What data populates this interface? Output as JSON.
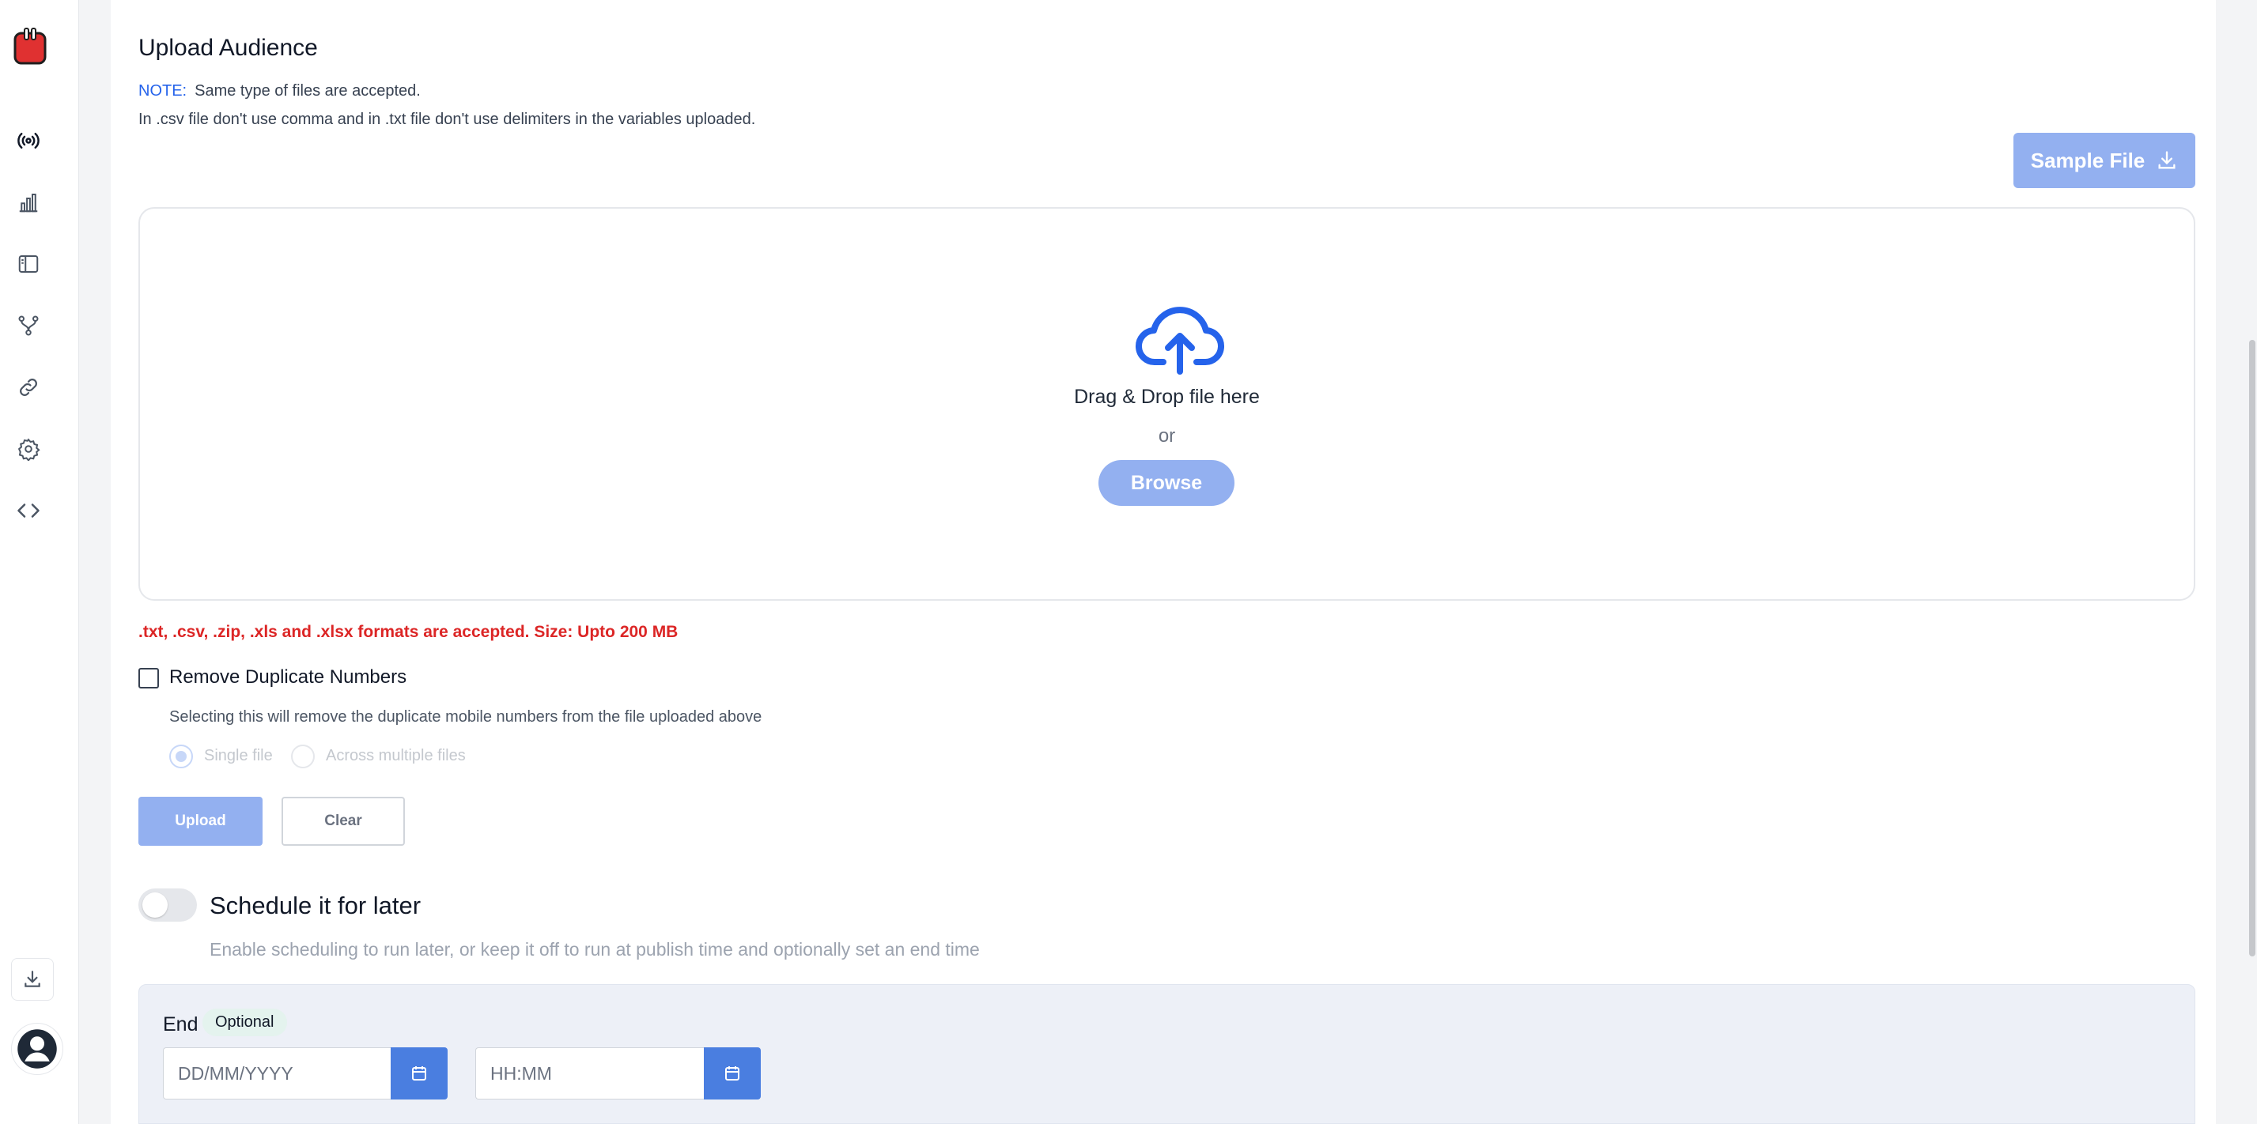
{
  "sidebar": {
    "nav_icons": [
      "broadcast-icon",
      "analytics-icon",
      "sidebar-panel-icon",
      "flow-icon",
      "link-icon",
      "settings-icon",
      "code-icon"
    ],
    "bottom_icons": [
      "download-icon",
      "user-avatar-icon"
    ]
  },
  "upload": {
    "title": "Upload Audience",
    "note_label": "NOTE:",
    "note_text": "Same type of files are accepted.",
    "note_line2": "In .csv file don't use comma and in .txt file don't use delimiters in the variables uploaded.",
    "sample_file_label": "Sample File",
    "drag_text": "Drag & Drop file here",
    "or_text": "or",
    "browse_label": "Browse",
    "formats_text": ".txt, .csv, .zip, .xls and .xlsx formats are accepted. Size: Upto 200 MB",
    "remove_duplicates_label": "Remove Duplicate Numbers",
    "remove_duplicates_checked": false,
    "remove_duplicates_helper": "Selecting this will remove the duplicate mobile numbers from the file uploaded above",
    "radio_options": [
      "Single file",
      "Across multiple files"
    ],
    "radio_selected": "Single file",
    "upload_label": "Upload",
    "clear_label": "Clear"
  },
  "schedule": {
    "toggle_on": false,
    "label": "Schedule it for later",
    "helper": "Enable scheduling to run later, or keep it off to run at publish time and optionally set an end time",
    "end_label": "End",
    "optional_badge": "Optional",
    "date_placeholder": "DD/MM/YYYY",
    "time_placeholder": "HH:MM"
  },
  "colors": {
    "primary": "#4a7ee0",
    "primary_disabled": "#93b0f0",
    "error": "#dc2626",
    "note_label": "#2563eb",
    "logo": "#e03131"
  }
}
